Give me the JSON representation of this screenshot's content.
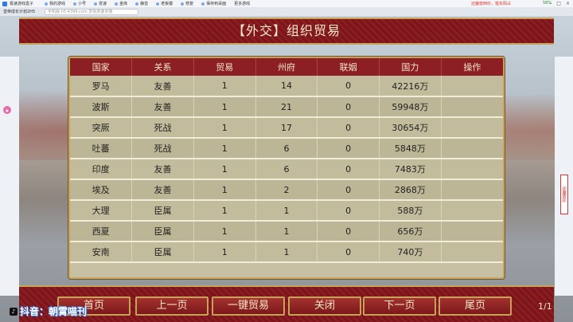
{
  "browser": {
    "app_name": "极速游戏盒子",
    "toolbar_items": [
      "我的游戏",
      "小号",
      "变速",
      "金库",
      "静音",
      "老板键",
      "修复",
      "保存到桌面",
      "更多游戏"
    ],
    "notice": "还魔兽西珍，错东阳占",
    "battery": "58%",
    "tab_title": "皇帝成长计划2H5",
    "address": "手机版 h5.4399.com 享受高速多端"
  },
  "game": {
    "title": "【外交】组织贸易",
    "table": {
      "columns": [
        "国家",
        "关系",
        "贸易",
        "州府",
        "联姻",
        "国力",
        "操作"
      ],
      "rows": [
        [
          "罗马",
          "友善",
          "1",
          "14",
          "0",
          "42216万",
          ""
        ],
        [
          "波斯",
          "友善",
          "1",
          "21",
          "0",
          "59948万",
          ""
        ],
        [
          "突厥",
          "死战",
          "1",
          "17",
          "0",
          "30654万",
          ""
        ],
        [
          "吐蕃",
          "死战",
          "1",
          "6",
          "0",
          "5848万",
          ""
        ],
        [
          "印度",
          "友善",
          "1",
          "6",
          "0",
          "7483万",
          ""
        ],
        [
          "埃及",
          "友善",
          "1",
          "2",
          "0",
          "2868万",
          ""
        ],
        [
          "大理",
          "臣属",
          "1",
          "1",
          "0",
          "588万",
          ""
        ],
        [
          "西夏",
          "臣属",
          "1",
          "1",
          "0",
          "656万",
          ""
        ],
        [
          "安南",
          "臣属",
          "1",
          "1",
          "0",
          "740万",
          ""
        ]
      ]
    },
    "buttons": {
      "first": "首页",
      "prev": "上一页",
      "trade_all": "一键贸易",
      "close": "关闭",
      "next": "下一页",
      "last": "尾页"
    },
    "page_indicator": "1/1",
    "side_float": "还魔西珍"
  },
  "watermark": "抖音：朝霄喵刊"
}
